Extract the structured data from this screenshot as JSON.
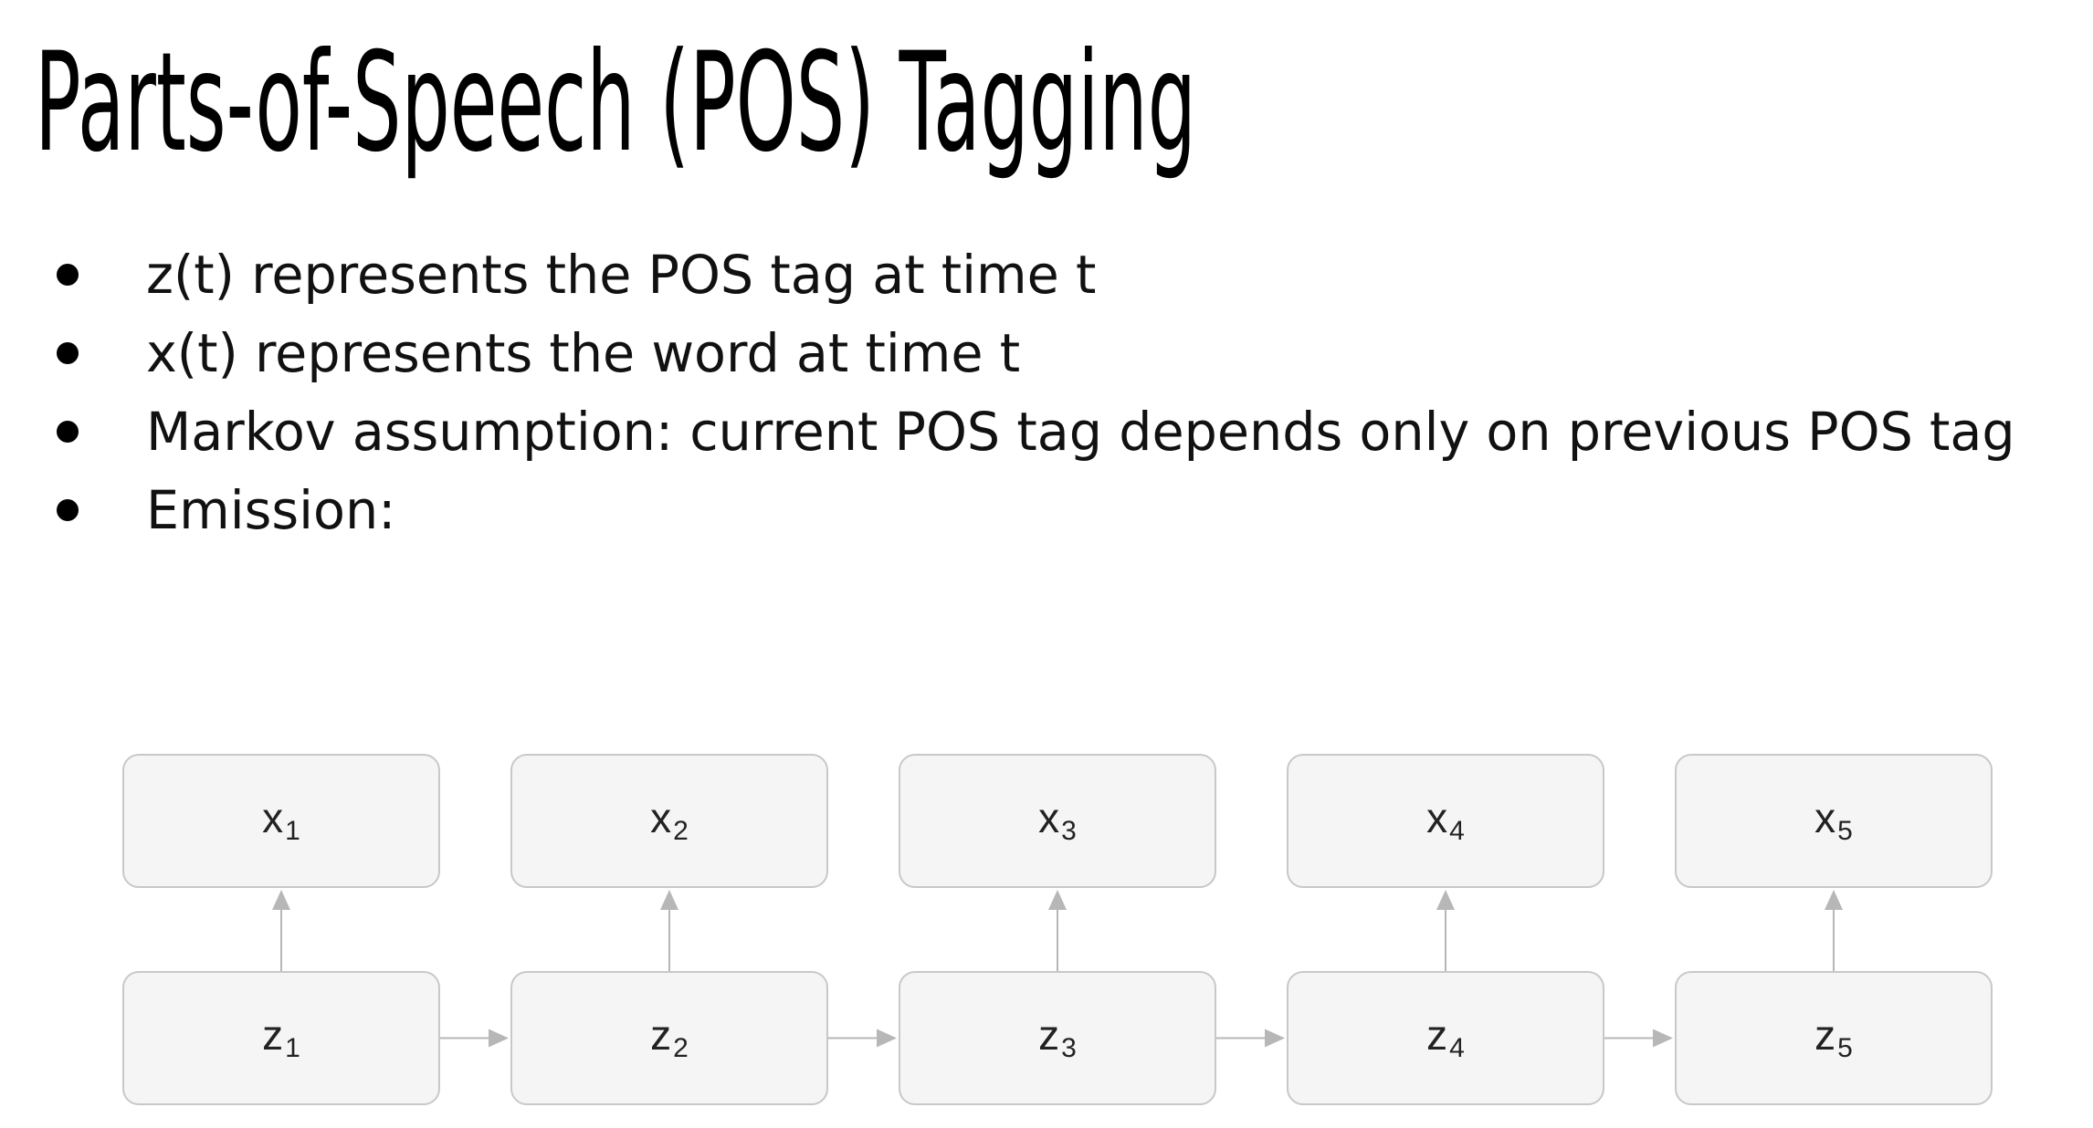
{
  "title": "Parts-of-Speech (POS) Tagging",
  "bullets": [
    "z(t) represents the POS tag at time t",
    "x(t) represents the word at time t",
    "Markov assumption: current POS tag depends only on previous POS tag",
    "Emission:"
  ],
  "diagram": {
    "observed": [
      {
        "var": "x",
        "sub": "1"
      },
      {
        "var": "x",
        "sub": "2"
      },
      {
        "var": "x",
        "sub": "3"
      },
      {
        "var": "x",
        "sub": "4"
      },
      {
        "var": "x",
        "sub": "5"
      }
    ],
    "hidden": [
      {
        "var": "z",
        "sub": "1"
      },
      {
        "var": "z",
        "sub": "2"
      },
      {
        "var": "z",
        "sub": "3"
      },
      {
        "var": "z",
        "sub": "4"
      },
      {
        "var": "z",
        "sub": "5"
      }
    ],
    "colors": {
      "node_fill": "#f5f5f5",
      "node_border": "#c8c8c8",
      "arrow": "#b7b7b7"
    }
  }
}
